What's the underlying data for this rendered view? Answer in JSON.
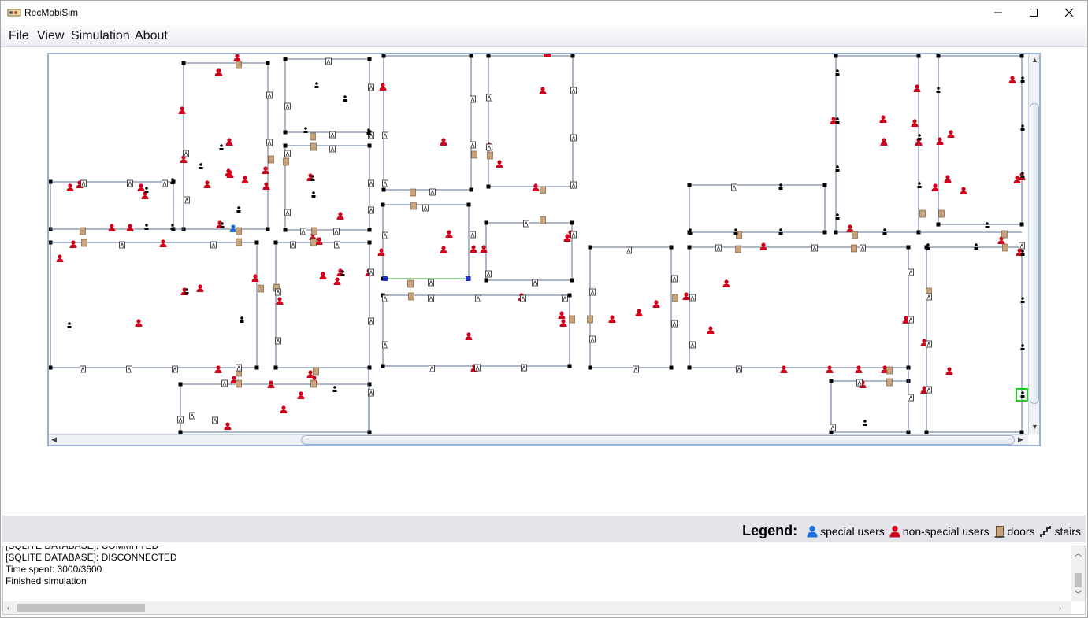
{
  "window": {
    "title": "RecMobiSim",
    "controls": {
      "minimize_icon": "minimize-icon",
      "maximize_icon": "maximize-icon",
      "close_icon": "close-icon"
    }
  },
  "menubar": {
    "items": [
      {
        "label": "File"
      },
      {
        "label": "View"
      },
      {
        "label": "Simulation"
      },
      {
        "label": "About"
      }
    ]
  },
  "map": {
    "colors": {
      "walls": "#5b6f96",
      "corner_nodes": "#000000",
      "non_special_user": "#d0021b",
      "special_user": "#1e6fd9",
      "door": "#c8a27a",
      "stairs": "#000000",
      "selected_highlight": "#22cc22",
      "green_edge": "#2ea52e",
      "blue_nodes": "#1f2fd0"
    },
    "icons": [
      "non-special-user-icon",
      "special-user-icon",
      "door-icon",
      "stairs-icon",
      "exit-sign-icon"
    ]
  },
  "legend": {
    "title": "Legend:",
    "entries": [
      {
        "icon": "special-user-icon",
        "label": "special users",
        "color": "#1e6fd9"
      },
      {
        "icon": "non-special-user-icon",
        "label": "non-special users",
        "color": "#d0021b"
      },
      {
        "icon": "door-icon",
        "label": "doors",
        "color": "#c8a27a"
      },
      {
        "icon": "stairs-icon",
        "label": "stairs",
        "color": "#000000"
      }
    ]
  },
  "log": {
    "lines": [
      "[SQLITE DATABASE]: COMMITTED",
      "[SQLITE DATABASE]: DISCONNECTED",
      "Time spent: 3000/3600",
      "Finished simulation"
    ]
  }
}
